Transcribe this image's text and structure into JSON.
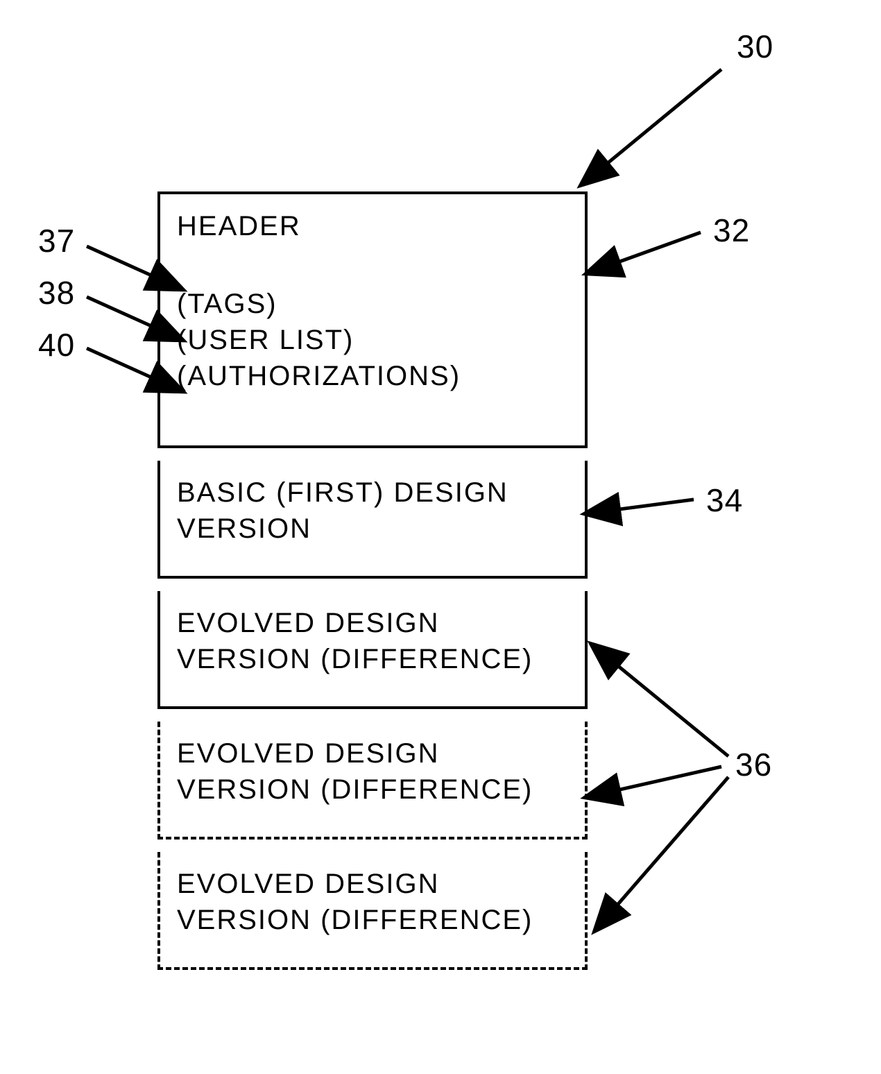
{
  "labels": {
    "l30": "30",
    "l32": "32",
    "l34": "34",
    "l36": "36",
    "l37": "37",
    "l38": "38",
    "l40": "40"
  },
  "header": {
    "title": "HEADER",
    "tags": "(TAGS)",
    "userlist": "(USER LIST)",
    "authorizations": "(AUTHORIZATIONS)"
  },
  "basic": "BASIC (FIRST) DESIGN VERSION",
  "evolved1": "EVOLVED DESIGN VERSION (DIFFERENCE)",
  "evolved2": "EVOLVED DESIGN VERSION (DIFFERENCE)",
  "evolved3": "EVOLVED DESIGN VERSION (DIFFERENCE)"
}
